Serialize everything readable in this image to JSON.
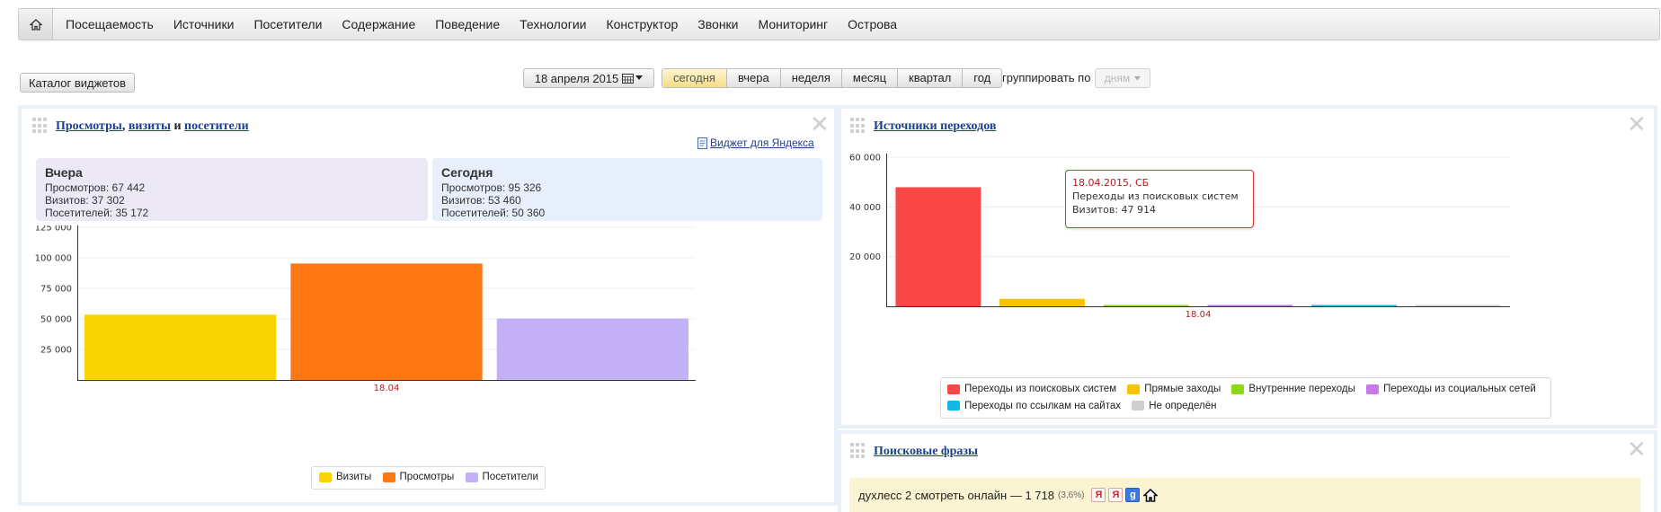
{
  "nav": {
    "items": [
      "Посещаемость",
      "Источники",
      "Посетители",
      "Содержание",
      "Поведение",
      "Технологии",
      "Конструктор",
      "Звонки",
      "Мониторинг",
      "Острова"
    ]
  },
  "toolbar": {
    "catalog_label": "Каталог виджетов",
    "date_label": "18 апреля 2015",
    "periods": [
      {
        "label": "сегодня",
        "active": true
      },
      {
        "label": "вчера",
        "active": false
      },
      {
        "label": "неделя",
        "active": false
      },
      {
        "label": "месяц",
        "active": false
      },
      {
        "label": "квартал",
        "active": false
      },
      {
        "label": "год",
        "active": false
      }
    ],
    "group_label": "группировать по",
    "group_value": "дням"
  },
  "widget_views": {
    "title_views": "Просмотры",
    "title_sep": ",",
    "title_visits": "визиты",
    "title_and": "и",
    "title_visitors": "посетители",
    "yandex_link": "Виджет для Яндекса",
    "yesterday": {
      "title": "Вчера",
      "views": "Просмотров: 67 442",
      "visits": "Визитов: 37 302",
      "visitors": "Посетителей: 35 172"
    },
    "today": {
      "title": "Сегодня",
      "views": "Просмотров: 95 326",
      "visits": "Визитов: 53 460",
      "visitors": "Посетителей: 50 360"
    }
  },
  "widget_sources": {
    "title": "Источники переходов",
    "tooltip": {
      "date": "18.04.2015, СБ",
      "series": "Переходы из поисковых систем",
      "value": "Визитов: 47 914"
    }
  },
  "widget_phrases": {
    "title": "Поисковые фразы",
    "phrase": "духлесс 2 смотреть онлайн — 1 718",
    "share": "(3,6%)"
  },
  "chart_data": [
    {
      "type": "bar",
      "categories": [
        "18.04"
      ],
      "series": [
        {
          "name": "Визиты",
          "values": [
            53460
          ],
          "color": "#f9d400"
        },
        {
          "name": "Просмотры",
          "values": [
            95326
          ],
          "color": "#fd7713"
        },
        {
          "name": "Посетители",
          "values": [
            50360
          ],
          "color": "#c2b1f7"
        }
      ],
      "yticks": [
        "25 000",
        "50 000",
        "75 000",
        "100 000",
        "125 000"
      ],
      "ylim": [
        0,
        125000
      ],
      "legend": "bottom"
    },
    {
      "type": "bar",
      "categories": [
        "18.04"
      ],
      "series": [
        {
          "name": "Переходы из поисковых систем",
          "values": [
            47914
          ],
          "color": "#fb4646"
        },
        {
          "name": "Прямые заходы",
          "values": [
            3000
          ],
          "color": "#fac300"
        },
        {
          "name": "Внутренние переходы",
          "values": [
            500
          ],
          "color": "#8dd61a"
        },
        {
          "name": "Переходы из социальных сетей",
          "values": [
            300
          ],
          "color": "#c679e7"
        },
        {
          "name": "Переходы по ссылкам на сайтах",
          "values": [
            100
          ],
          "color": "#13b7e9"
        },
        {
          "name": "Не определён",
          "values": [
            0
          ],
          "color": "#cfcfcf"
        }
      ],
      "yticks": [
        "20 000",
        "40 000",
        "60 000"
      ],
      "ylim": [
        0,
        60000
      ],
      "legend": "bottom"
    }
  ]
}
